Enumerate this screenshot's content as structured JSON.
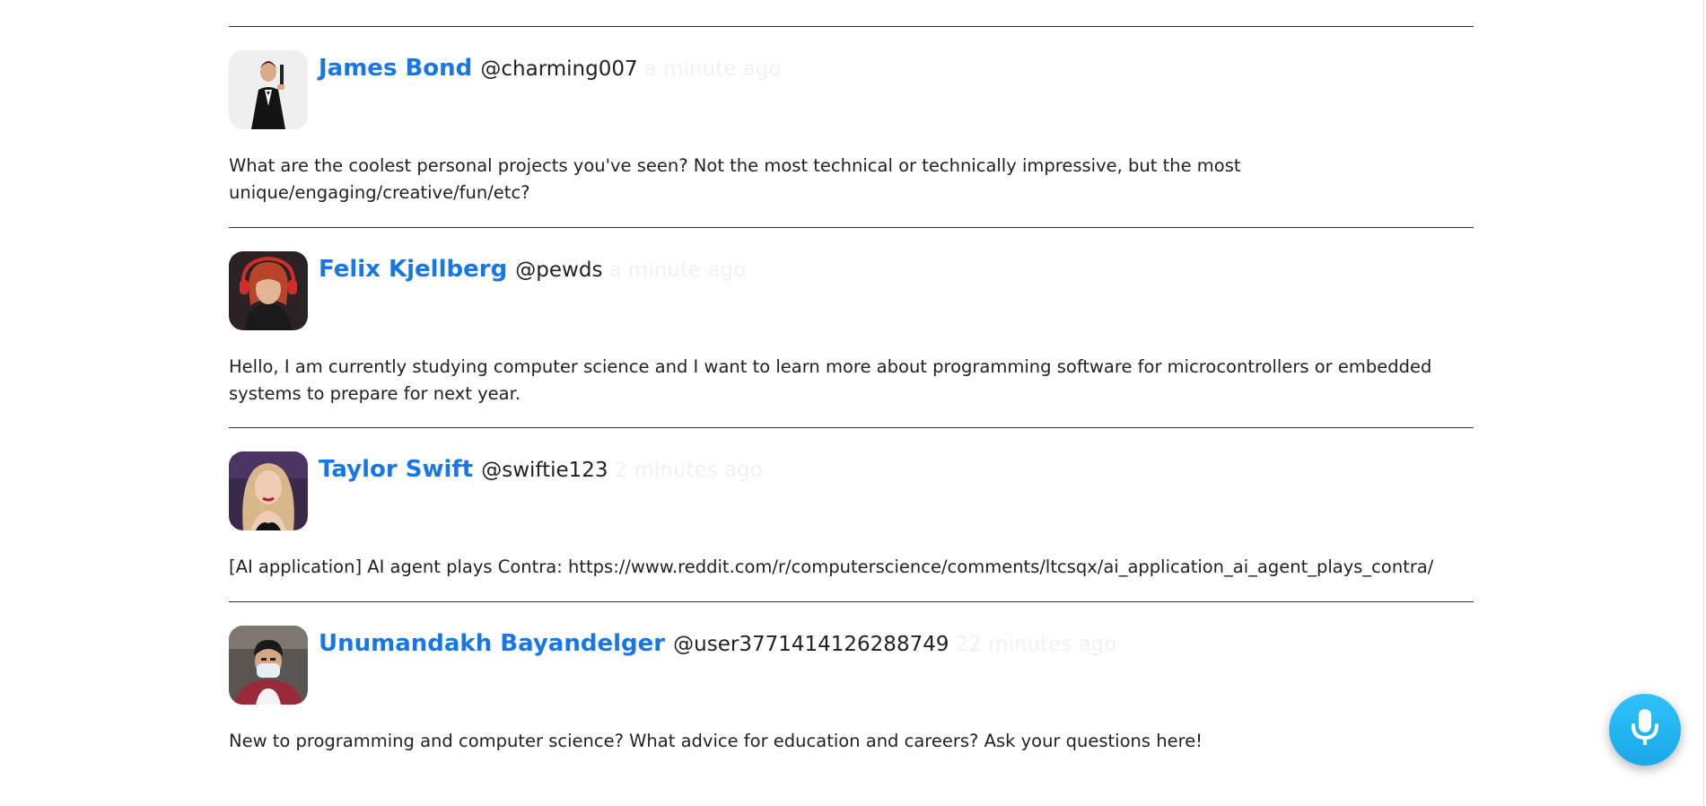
{
  "posts": [
    {
      "name": "James Bond",
      "handle": "@charming007",
      "time": "a minute ago",
      "body": "What are the coolest personal projects you've seen? Not the most technical or technically impressive, but the most unique/engaging/creative/fun/etc?"
    },
    {
      "name": "Felix Kjellberg",
      "handle": "@pewds",
      "time": "a minute ago",
      "body": "Hello, I am currently studying computer science and I want to learn more about programming software for microcontrollers or embedded systems to prepare for next year."
    },
    {
      "name": "Taylor Swift",
      "handle": "@swiftie123",
      "time": "2 minutes ago",
      "body": "[AI application] AI agent plays Contra: https://www.reddit.com/r/computerscience/comments/ltcsqx/ai_application_ai_agent_plays_contra/"
    },
    {
      "name": "Unumandakh Bayandelger",
      "handle": "@user3771414126288749",
      "time": "22 minutes ago",
      "body": "New to programming and computer science? What advice for education and careers? Ask your questions here!"
    }
  ],
  "colors": {
    "name_link": "#1877e6",
    "timestamp": "#f1f1f1",
    "mic_button": "#1fb2ee"
  },
  "icons": {
    "mic": "microphone-icon"
  }
}
